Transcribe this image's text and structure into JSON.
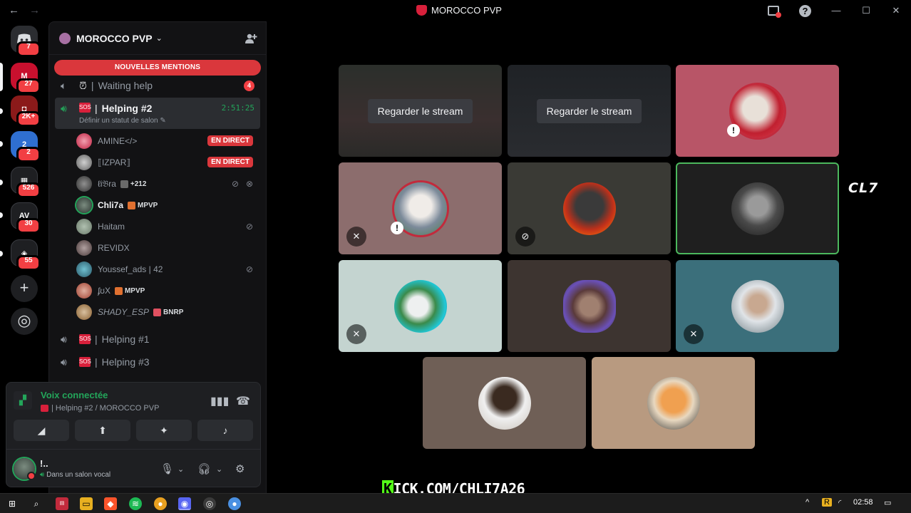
{
  "window": {
    "title": "MOROCCO PVP",
    "back_label": "←",
    "forward_label": "→",
    "help_label": "?",
    "minimize_label": "—",
    "maximize_label": "☐",
    "close_label": "✕"
  },
  "servers": [
    {
      "name": "Discord home",
      "badge": "7"
    },
    {
      "name": "MOROCCO PVP",
      "badge": "27"
    },
    {
      "name": "Server 3",
      "badge": "2K+"
    },
    {
      "name": "Server 4",
      "badge": "2"
    },
    {
      "name": "Server 5",
      "badge": "526"
    },
    {
      "name": "Server 6",
      "badge": "30"
    },
    {
      "name": "Server 7",
      "badge": "55"
    }
  ],
  "rail": {
    "add_label": "+",
    "explore_label": "◎"
  },
  "guild": {
    "name": "MOROCCO PVP",
    "chevron": "⌄",
    "invite_icon": "+"
  },
  "mentions_banner": "NOUVELLES MENTIONS",
  "channels": [
    {
      "name": "Waiting help",
      "count": "4"
    },
    {
      "name": "Helping #2",
      "timer": "2:51:25",
      "status": "Définir un statut de salon ✎"
    },
    {
      "name": "Helping #1"
    },
    {
      "name": "Helping #3"
    }
  ],
  "members": [
    {
      "name": "AMINE</>",
      "live": "EN DIRECT"
    },
    {
      "name": "⟦IZPAR⟧",
      "live": "EN DIRECT"
    },
    {
      "name": "ℓi𝔅ra",
      "tag": "+212"
    },
    {
      "name": "Chli7a",
      "tag": "MPVP"
    },
    {
      "name": "Haitam"
    },
    {
      "name": "REVIDX"
    },
    {
      "name": "Youssef_ads | 42"
    },
    {
      "name": "ʄʊX",
      "tag": "MPVP"
    },
    {
      "name": "SHADY_ESP",
      "tag": "BNRP"
    }
  ],
  "voice_panel": {
    "title": "Voix connectée",
    "subtitle": "| Helping #2 / MOROCCO PVP",
    "btn_video": "◢",
    "btn_share": "⬆",
    "btn_activities": "✦",
    "btn_soundboard": "♪"
  },
  "user": {
    "name": "!..",
    "status": "Dans un salon vocal"
  },
  "stage": {
    "watch_stream_label": "Regarder le stream",
    "overlay_text": "CL7",
    "kick_prefix": "K",
    "kick_text": "ICK.COM/CHLI7A26"
  },
  "taskbar": {
    "clock": "02:58"
  },
  "colors": {
    "accent_green": "#23a55a",
    "danger_red": "#da373c",
    "brand_red": "#d8203b",
    "kick_green": "#53fc18"
  }
}
